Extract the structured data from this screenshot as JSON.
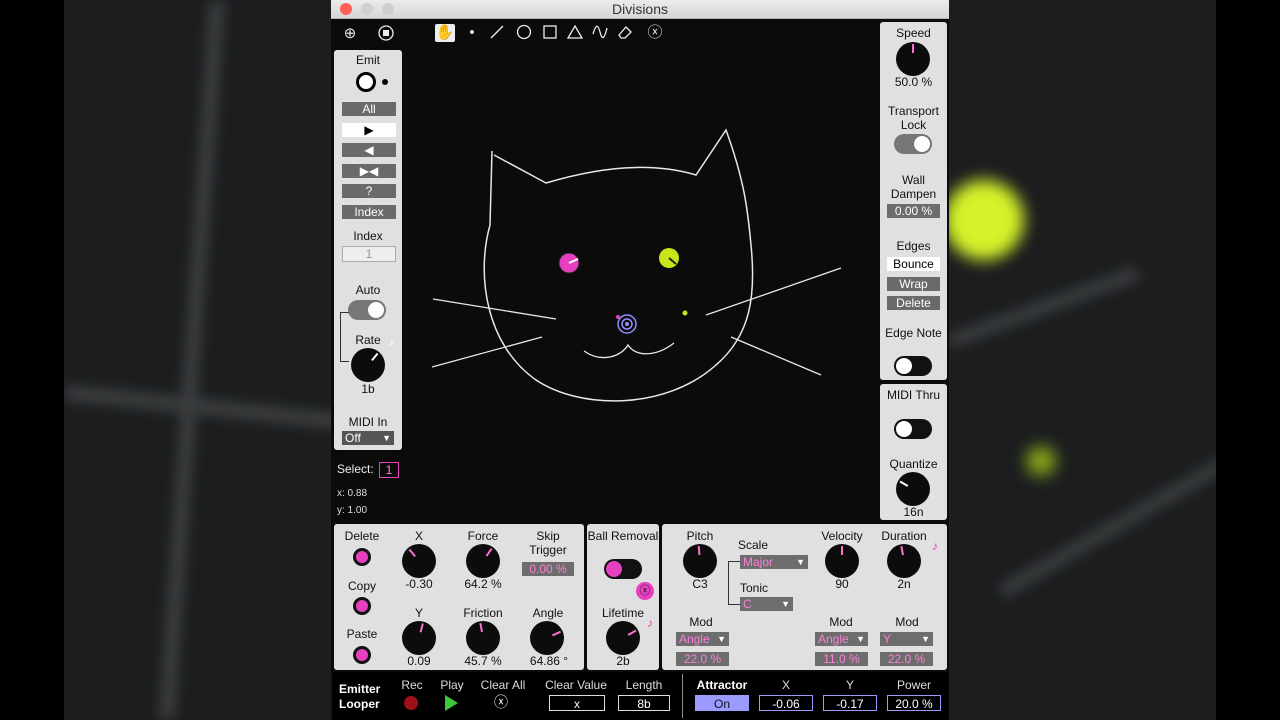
{
  "window": {
    "title": "Divisions"
  },
  "toolbar": {
    "icons": [
      "add-icon",
      "save-icon",
      "hand-icon",
      "point-icon",
      "line-icon",
      "circle-icon",
      "square-icon",
      "triangle-icon",
      "wave-icon",
      "eraser-icon",
      "clear-icon"
    ]
  },
  "emit": {
    "label": "Emit",
    "buttons": [
      "All",
      "▶",
      "◀",
      "▶◀",
      "?",
      "Index"
    ],
    "index_label": "Index",
    "index_value": "1",
    "auto_label": "Auto",
    "rate_label": "Rate",
    "rate_value": "1b",
    "midi_in_label": "MIDI In",
    "midi_in_value": "Off"
  },
  "select": {
    "label": "Select:",
    "value": "1",
    "x": "x: 0.88",
    "y": "y: 1.00"
  },
  "right": {
    "speed_label": "Speed",
    "speed_value": "50.0 %",
    "transport_lock_label": "Transport Lock",
    "wall_dampen_label": "Wall Dampen",
    "wall_dampen_value": "0.00 %",
    "edges_label": "Edges",
    "edges_options": [
      "Bounce",
      "Wrap",
      "Delete"
    ],
    "edge_note_label": "Edge Note",
    "midi_thru_label": "MIDI Thru",
    "quantize_label": "Quantize",
    "quantize_value": "16n"
  },
  "bottom": {
    "delete": "Delete",
    "copy": "Copy",
    "paste": "Paste",
    "x_label": "X",
    "x_value": "-0.30",
    "y_label": "Y",
    "y_value": "0.09",
    "force_label": "Force",
    "force_value": "64.2 %",
    "friction_label": "Friction",
    "friction_value": "45.7 %",
    "skip_label": "Skip Trigger",
    "skip_value": "0.00 %",
    "angle_label": "Angle",
    "angle_value": "64.86 °",
    "ball_removal_label": "Ball Removal",
    "lifetime_label": "Lifetime",
    "lifetime_value": "2b",
    "pitch_label": "Pitch",
    "pitch_value": "C3",
    "scale_label": "Scale",
    "scale_value": "Major",
    "tonic_label": "Tonic",
    "tonic_value": "C",
    "velocity_label": "Velocity",
    "velocity_value": "90",
    "duration_label": "Duration",
    "duration_value": "2n",
    "mod_label": "Mod",
    "mod1_value": "Angle",
    "mod1_amount": "22.0 %",
    "mod2_value": "Angle",
    "mod2_amount": "11.0 %",
    "mod3_value": "Y",
    "mod3_amount": "22.0 %"
  },
  "looper": {
    "label": "Emitter Looper",
    "rec": "Rec",
    "play": "Play",
    "clear_all": "Clear All",
    "clear_value": "Clear Value",
    "clear_value_field": "x",
    "length": "Length",
    "length_value": "8b",
    "attractor": "Attractor",
    "attractor_value": "On",
    "x": "X",
    "x_value": "-0.06",
    "y": "Y",
    "y_value": "-0.17",
    "power": "Power",
    "power_value": "20.0 %"
  }
}
